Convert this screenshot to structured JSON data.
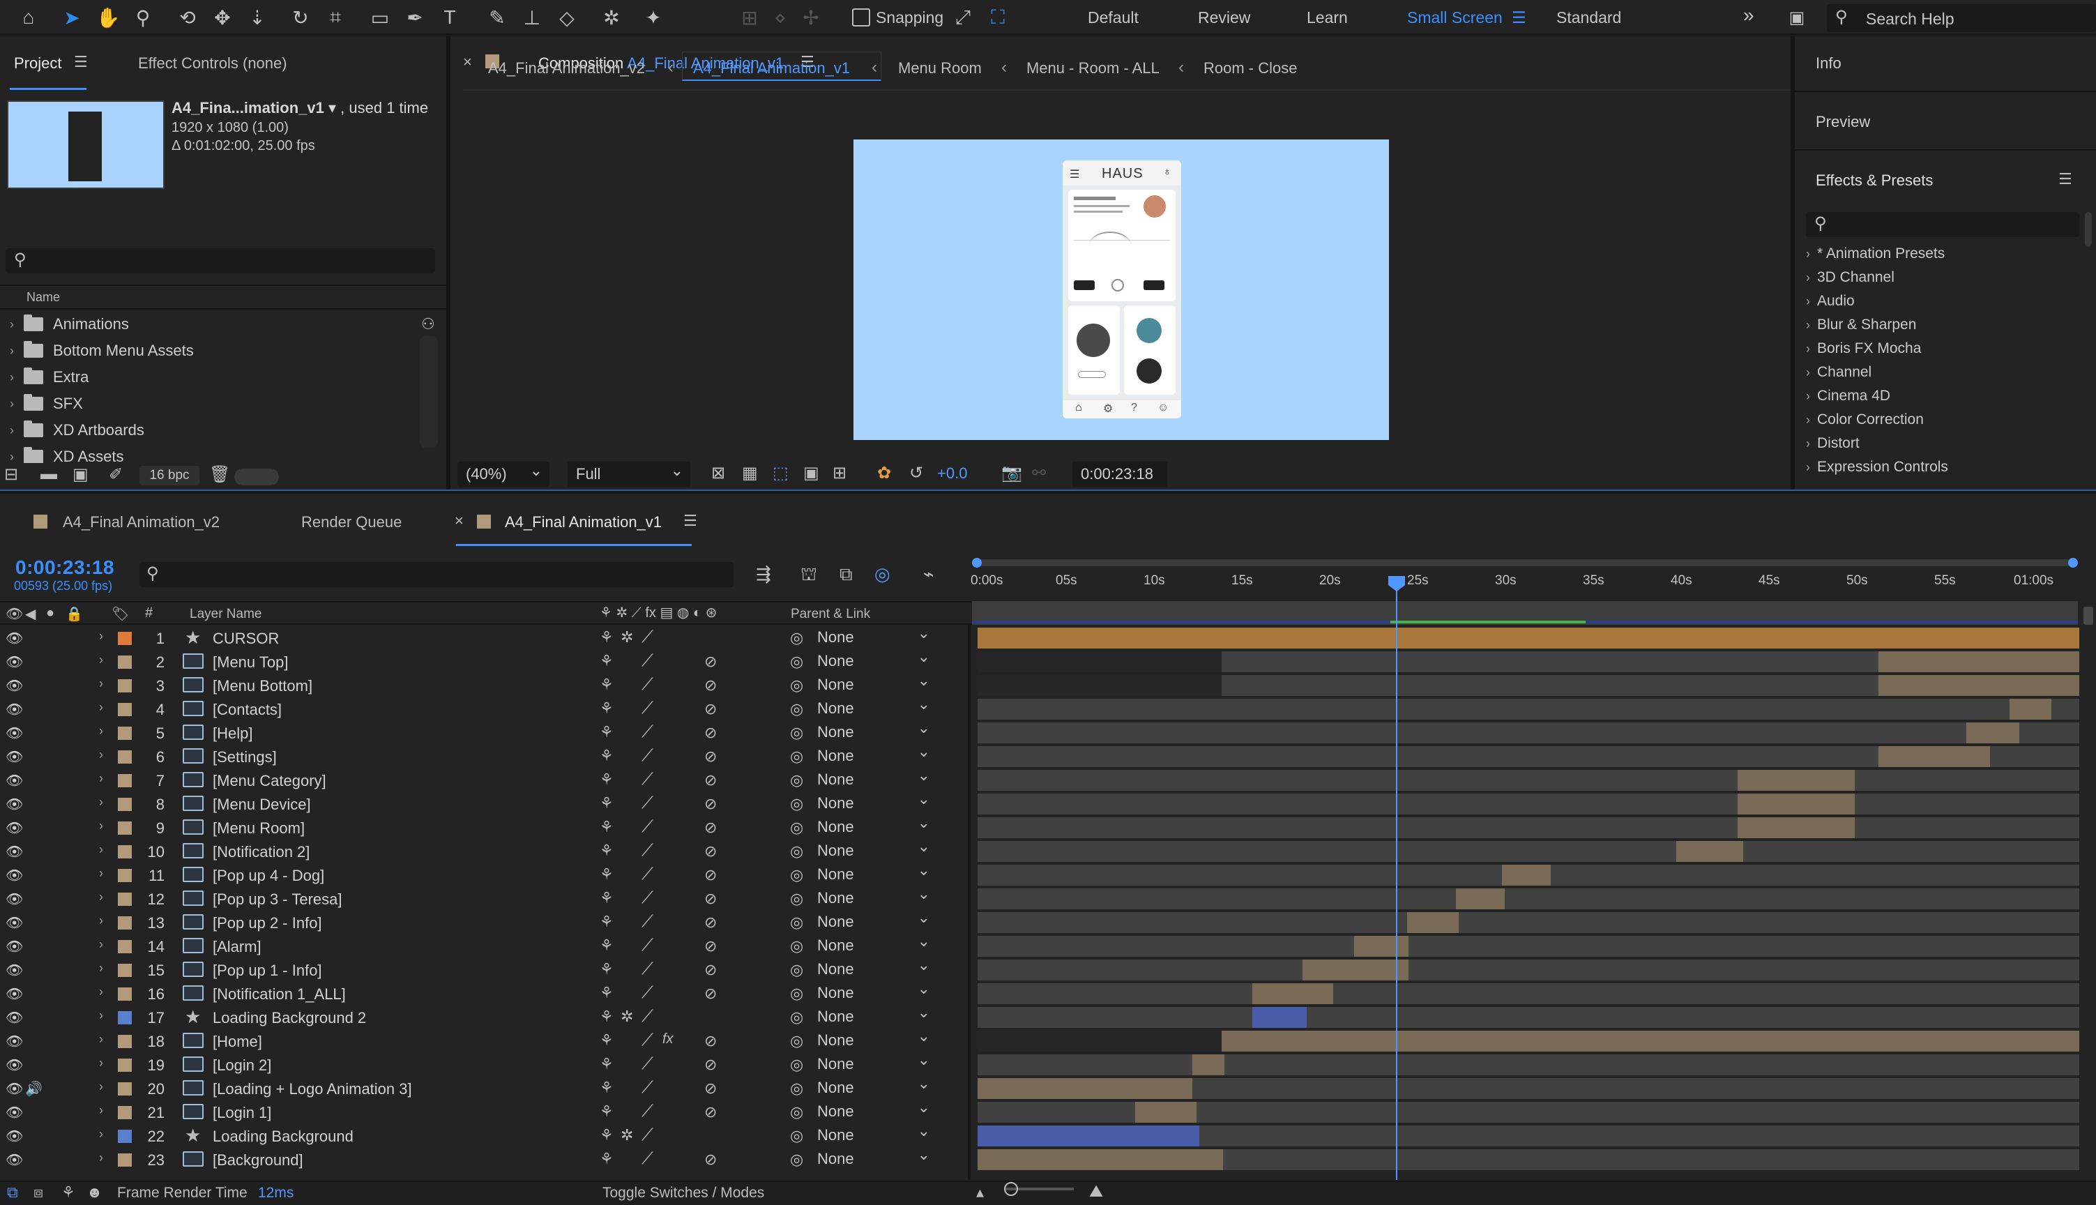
{
  "toolbar": {
    "snapping_label": "Snapping",
    "workspaces": [
      "Default",
      "Review",
      "Learn",
      "Small Screen",
      "Standard"
    ],
    "selected_workspace": "Small Screen",
    "search_placeholder": "Search Help"
  },
  "project": {
    "tab_label": "Project",
    "effect_controls_label": "Effect Controls (none)",
    "selected_item_name": "A4_Fina...imation_v1",
    "selected_item_usage": ", used 1 time",
    "selected_item_size": "1920 x 1080 (1.00)",
    "selected_item_duration": "Δ 0:01:02:00, 25.00 fps",
    "column_name": "Name",
    "folders": [
      "Animations",
      "Bottom Menu Assets",
      "Extra",
      "SFX",
      "XD Artboards",
      "XD Assets"
    ],
    "bpc_label": "16 bpc"
  },
  "composition": {
    "prefix": "Composition",
    "name": "A4_Final Animation_v1",
    "breadcrumbs": [
      "A4_Final Animation_v2",
      "A4_Final Animation_v1",
      "Menu Room",
      "Menu - Room - ALL",
      "Room - Close"
    ],
    "zoom": "(40%)",
    "resolution": "Full",
    "exposure": "+0.0",
    "timecode": "0:00:23:18",
    "phone_brand": "HAUS"
  },
  "right_panel": {
    "info_label": "Info",
    "preview_label": "Preview",
    "effects_label": "Effects & Presets",
    "effects": [
      "* Animation Presets",
      "3D Channel",
      "Audio",
      "Blur & Sharpen",
      "Boris FX Mocha",
      "Channel",
      "Cinema 4D",
      "Color Correction",
      "Distort",
      "Expression Controls"
    ]
  },
  "timeline": {
    "tabs": [
      "A4_Final Animation_v2",
      "Render Queue",
      "A4_Final Animation_v1"
    ],
    "current_time": "0:00:23:18",
    "frame_info": "00593 (25.00 fps)",
    "col_layer_name": "Layer Name",
    "col_parent": "Parent & Link",
    "ruler": [
      "0:00s",
      "05s",
      "10s",
      "15s",
      "20s",
      "25s",
      "30s",
      "35s",
      "40s",
      "45s",
      "50s",
      "55s",
      "01:00s"
    ],
    "layers": [
      {
        "num": "1",
        "name": "CURSOR",
        "type": "star",
        "color": "#e07a3a",
        "parent": "None"
      },
      {
        "num": "2",
        "name": "[Menu Top]",
        "type": "comp",
        "color": "#b39a7b",
        "parent": "None"
      },
      {
        "num": "3",
        "name": "[Menu Bottom]",
        "type": "comp",
        "color": "#b39a7b",
        "parent": "None"
      },
      {
        "num": "4",
        "name": "[Contacts]",
        "type": "comp",
        "color": "#b39a7b",
        "parent": "None"
      },
      {
        "num": "5",
        "name": "[Help]",
        "type": "comp",
        "color": "#b39a7b",
        "parent": "None"
      },
      {
        "num": "6",
        "name": "[Settings]",
        "type": "comp",
        "color": "#b39a7b",
        "parent": "None"
      },
      {
        "num": "7",
        "name": "[Menu Category]",
        "type": "comp",
        "color": "#b39a7b",
        "parent": "None"
      },
      {
        "num": "8",
        "name": "[Menu Device]",
        "type": "comp",
        "color": "#b39a7b",
        "parent": "None"
      },
      {
        "num": "9",
        "name": "[Menu Room]",
        "type": "comp",
        "color": "#b39a7b",
        "parent": "None"
      },
      {
        "num": "10",
        "name": "[Notification 2]",
        "type": "comp",
        "color": "#b39a7b",
        "parent": "None"
      },
      {
        "num": "11",
        "name": "[Pop up 4 - Dog]",
        "type": "comp",
        "color": "#b39a7b",
        "parent": "None"
      },
      {
        "num": "12",
        "name": "[Pop up 3 - Teresa]",
        "type": "comp",
        "color": "#b39a7b",
        "parent": "None"
      },
      {
        "num": "13",
        "name": "[Pop up 2 - Info]",
        "type": "comp",
        "color": "#b39a7b",
        "parent": "None"
      },
      {
        "num": "14",
        "name": "[Alarm]",
        "type": "comp",
        "color": "#b39a7b",
        "parent": "None"
      },
      {
        "num": "15",
        "name": "[Pop up 1 - Info]",
        "type": "comp",
        "color": "#b39a7b",
        "parent": "None"
      },
      {
        "num": "16",
        "name": "[Notification 1_ALL]",
        "type": "comp",
        "color": "#b39a7b",
        "parent": "None"
      },
      {
        "num": "17",
        "name": "Loading Background 2",
        "type": "star",
        "color": "#5a7fcf",
        "parent": "None"
      },
      {
        "num": "18",
        "name": "[Home]",
        "type": "comp",
        "color": "#b39a7b",
        "parent": "None",
        "fx": true
      },
      {
        "num": "19",
        "name": "[Login 2]",
        "type": "comp",
        "color": "#b39a7b",
        "parent": "None"
      },
      {
        "num": "20",
        "name": "[Loading + Logo Animation 3]",
        "type": "comp",
        "color": "#b39a7b",
        "parent": "None",
        "audio": true
      },
      {
        "num": "21",
        "name": "[Login 1]",
        "type": "comp",
        "color": "#b39a7b",
        "parent": "None"
      },
      {
        "num": "22",
        "name": "Loading Background",
        "type": "star",
        "color": "#5a7fcf",
        "parent": "None"
      },
      {
        "num": "23",
        "name": "[Background]",
        "type": "comp",
        "color": "#b39a7b",
        "parent": "None"
      }
    ]
  },
  "status": {
    "frame_render_label": "Frame Render Time",
    "frame_render_value": "12ms",
    "toggle_label": "Toggle Switches / Modes"
  },
  "colors": {
    "accent": "#3a8fff",
    "viewer_bg": "#a9d4fe",
    "bar_tan": "#7a6b57",
    "bar_orange": "#a8773a",
    "bar_blue": "#4a5da8"
  }
}
